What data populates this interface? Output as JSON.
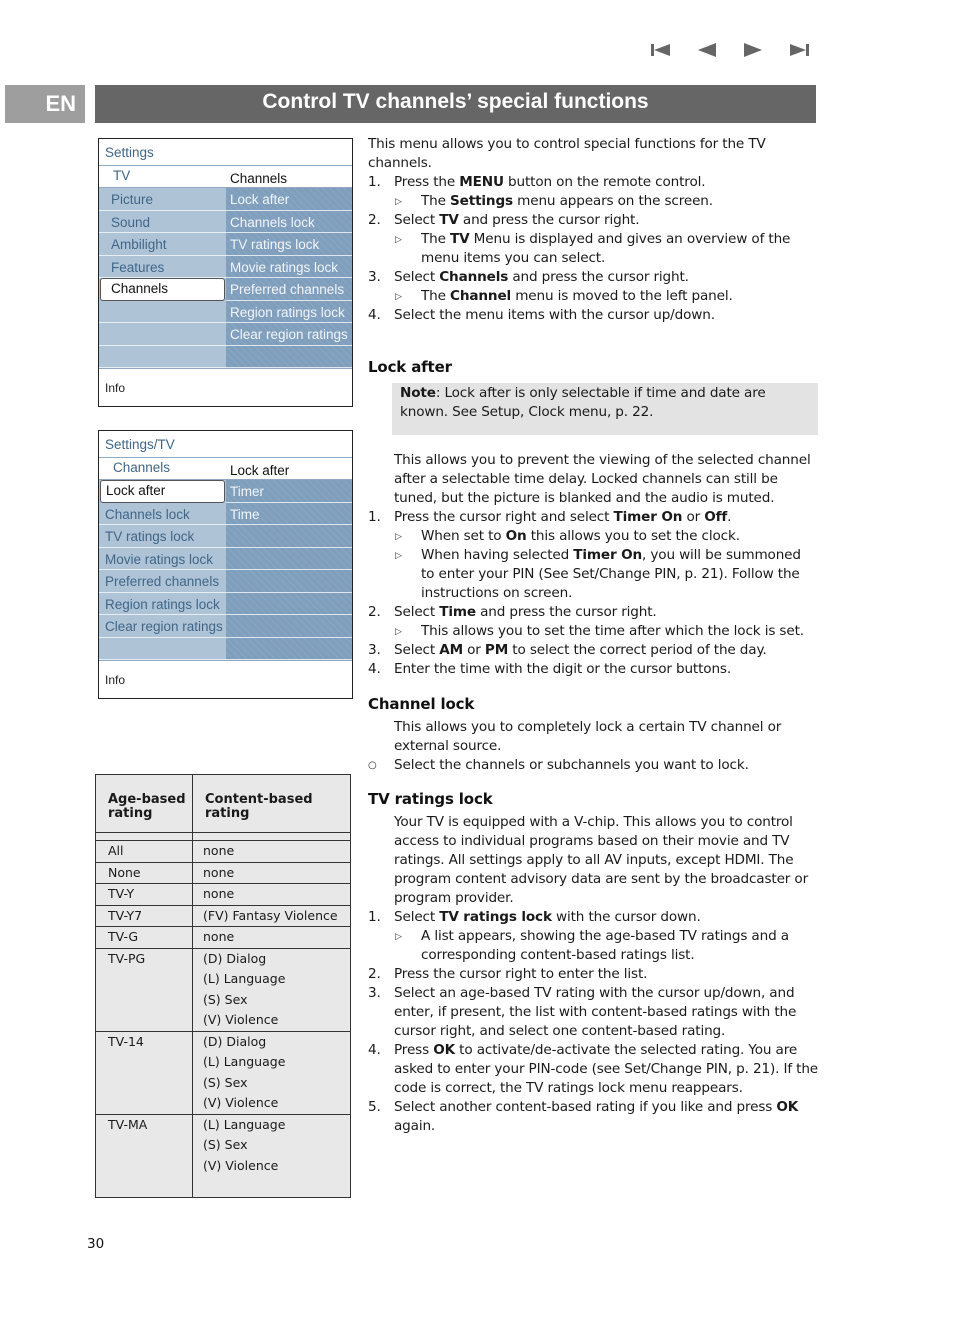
{
  "nav": {
    "buttons": [
      {
        "name": "first-page",
        "icon": "skip-back-icon"
      },
      {
        "name": "previous-page",
        "icon": "triangle-left-icon"
      },
      {
        "name": "next-page",
        "icon": "triangle-right-icon"
      },
      {
        "name": "last-page",
        "icon": "skip-forward-icon"
      }
    ],
    "color": "#666666"
  },
  "header": {
    "lang": "EN",
    "title": "Control TV channels’ special functions",
    "title_bg": "#666666",
    "lang_bg": "#9e9e9e"
  },
  "menu1": {
    "crumb": "Settings",
    "left_head": "TV",
    "right_head": "Channels",
    "left_items": [
      "Picture",
      "Sound",
      "Ambilight",
      "Features",
      "Channels",
      "",
      "",
      ""
    ],
    "selected_left_index": 4,
    "right_items": [
      "Lock after",
      "Channels lock",
      "TV ratings lock",
      "Movie ratings lock",
      "Preferred channels",
      "Region ratings lock",
      "Clear region ratings",
      ""
    ],
    "info": "Info"
  },
  "menu2": {
    "crumb": "Settings/TV",
    "left_head": "Channels",
    "right_head": "Lock after",
    "left_items": [
      "Lock after",
      "Channels lock",
      "TV ratings lock",
      "Movie ratings lock",
      "Preferred channels",
      "Region ratings lock",
      "Clear region ratings",
      ""
    ],
    "selected_left_index": 0,
    "right_items": [
      "Timer",
      "Time",
      "",
      "",
      "",
      "",
      "",
      ""
    ],
    "info": "Info"
  },
  "ratings_table": {
    "headers": [
      "Age-based\nrating",
      "Content-based\nrating"
    ],
    "rows": [
      {
        "age": "All",
        "content": [
          "none"
        ]
      },
      {
        "age": "None",
        "content": [
          "none"
        ]
      },
      {
        "age": "TV-Y",
        "content": [
          "none"
        ]
      },
      {
        "age": "TV-Y7",
        "content": [
          "(FV) Fantasy Violence"
        ]
      },
      {
        "age": "TV-G",
        "content": [
          "none"
        ]
      },
      {
        "age": "TV-PG",
        "content": [
          "(D) Dialog",
          "(L) Language",
          "(S) Sex",
          "(V) Violence"
        ]
      },
      {
        "age": "TV-14",
        "content": [
          "(D) Dialog",
          "(L) Language",
          "(S) Sex",
          "(V) Violence"
        ]
      },
      {
        "age": "TV-MA",
        "content": [
          "(L) Language",
          "(S) Sex",
          "(V) Violence"
        ]
      }
    ]
  },
  "intro": {
    "text": "This menu allows you to control special functions for the TV channels.",
    "steps": [
      {
        "n": "1.",
        "html": "Press the <b>MENU</b> button on the remote control.",
        "subs": [
          "The <b>Settings</b> menu appears on the screen."
        ]
      },
      {
        "n": "2.",
        "html": "Select <b>TV</b> and press the cursor right.",
        "subs": [
          "The <b>TV</b> Menu is displayed and gives an overview of the menu items you can select."
        ]
      },
      {
        "n": "3.",
        "html": "Select <b>Channels</b> and press the cursor right.",
        "subs": [
          "The <b>Channel</b> menu is moved to the left panel."
        ]
      },
      {
        "n": "4.",
        "html": "Select the menu items with the cursor up/down.",
        "subs": []
      }
    ]
  },
  "lock_after": {
    "heading": "Lock after",
    "note_label": "Note",
    "note_text": ": Lock after is only selectable if time and date are known. See Setup, Clock menu, p. 22.",
    "desc": "This allows you to prevent the viewing of the selected channel after a selectable time delay. Locked channels can still be tuned, but the picture is blanked and the audio is muted.",
    "steps": [
      {
        "n": "1.",
        "html": "Press the cursor right and select <b>Timer On</b> or <b>Off</b>.",
        "subs": [
          "When set to <b>On</b> this allows you to set the clock.",
          "When having selected <b>Timer On</b>, you will be summoned to enter your PIN (See Set/Change PIN, p. 21). Follow the instructions on screen."
        ]
      },
      {
        "n": "2.",
        "html": "Select <b>Time</b> and press the cursor right.",
        "subs": [
          "This allows you to set the time after which the lock is set."
        ]
      },
      {
        "n": "3.",
        "html": "Select <b>AM</b> or <b>PM</b> to select the correct period of the day.",
        "subs": []
      },
      {
        "n": "4.",
        "html": "Enter the time with the digit or the cursor buttons.",
        "subs": []
      }
    ]
  },
  "channel_lock": {
    "heading": "Channel lock",
    "desc": "This allows you to completely lock a certain TV channel or external source.",
    "bullet": "Select the channels or subchannels you want to lock."
  },
  "tv_ratings_lock": {
    "heading": "TV ratings lock",
    "desc": "Your TV is equipped with a V-chip. This allows you to control access to individual programs based on their movie and TV ratings. All settings apply to all AV inputs, except HDMI. The program content advisory data are sent by the broadcaster or program provider.",
    "steps": [
      {
        "n": "1.",
        "html": "Select <b>TV ratings lock</b> with the cursor down.",
        "subs": [
          "A list appears, showing the age-based TV ratings and a corresponding content-based ratings list."
        ]
      },
      {
        "n": "2.",
        "html": "Press the cursor right to enter the list.",
        "subs": []
      },
      {
        "n": "3.",
        "html": "Select an age-based TV rating with the cursor up/down, and enter, if present, the list with content-based ratings with the cursor right, and select one content-based rating.",
        "subs": []
      },
      {
        "n": "4.",
        "html": "Press <b>OK</b> to activate/de-activate the selected rating. You are asked to enter your PIN-code (see Set/Change PIN, p. 21). If the code is correct, the TV ratings lock menu reappears.",
        "subs": []
      },
      {
        "n": "5.",
        "html": "Select another content-based rating if you like and press <b>OK</b> again.",
        "subs": []
      }
    ]
  },
  "page_number": "30"
}
